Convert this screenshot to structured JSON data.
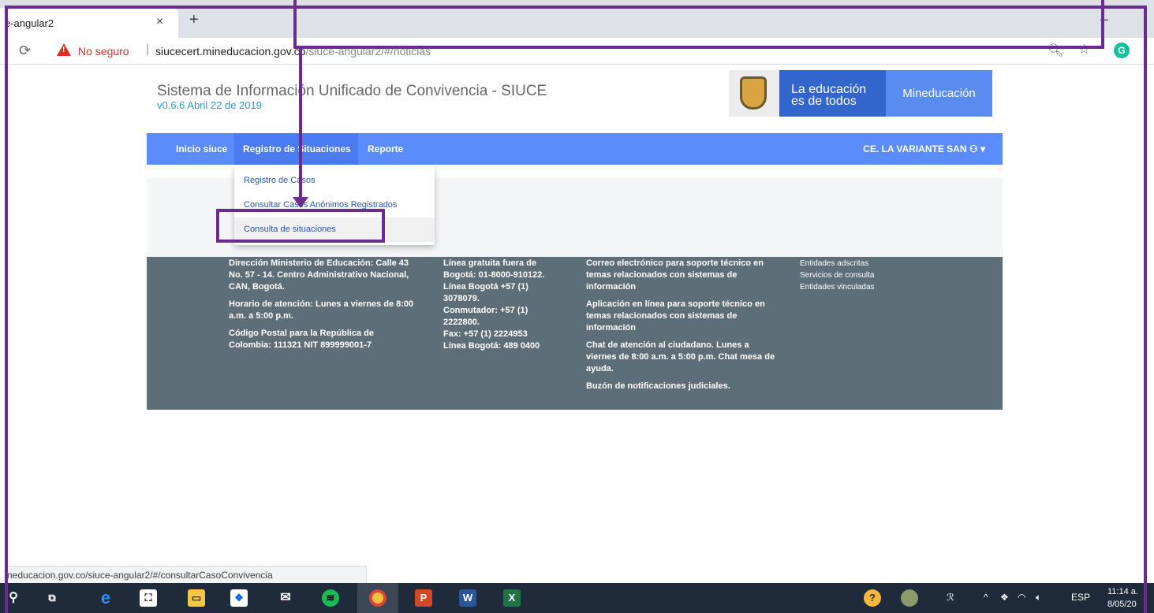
{
  "browser": {
    "tab_title": "e-angular2",
    "tab_close": "×",
    "new_tab": "+",
    "minimize": "–",
    "insecure_label": "No seguro",
    "url_host": "siucecert.mineducacion.gov.co",
    "url_path": "/siuce-angular2/#/noticias",
    "status_url": "neducacion.gov.co/siuce-angular2/#/consultarCasoConvivencia"
  },
  "header": {
    "title": "Sistema de Información Unificado de Convivencia - SIUCE",
    "version": "v0.6.6 Abril 22 de 2019",
    "logo_line1": "La educación",
    "logo_line2": "es de todos",
    "logo_ministry": "Mineducación"
  },
  "nav": {
    "items": [
      "Inicio siuce",
      "Registro de Situaciones",
      "Reporte"
    ],
    "user": "CE. LA VARIANTE SAN"
  },
  "dropdown": {
    "items": [
      "Registro de Casos",
      "Consultar Casos Anónimos Registrados",
      "Consulta de situaciones"
    ]
  },
  "footer": {
    "col1": [
      "Dirección Ministerio de Educación: Calle 43 No. 57 - 14. Centro Administrativo Nacional, CAN, Bogotá.",
      "Horario de atención: Lunes a viernes de 8:00 a.m. a 5:00 p.m.",
      "Código Postal para la República de Colombia: 111321 NIT 899999001-7"
    ],
    "col2": [
      "Línea gratuita fuera de Bogotá: 01-8000-910122.",
      "Línea Bogotá +57 (1) 3078079.",
      "Conmutador: +57 (1) 2222800.",
      "Fax: +57 (1) 2224953",
      "Línea Bogotá: 489 0400"
    ],
    "col3": [
      "Correo electrónico para soporte técnico en temas relacionados con sistemas de información",
      "Aplicación en línea para soporte técnico en temas relacionados con sistemas de información",
      "Chat de atención al ciudadano. Lunes a viernes de 8:00 a.m. a 5:00 p.m. Chat mesa de ayuda.",
      "Buzón de notificaciones judiciales."
    ],
    "col4": [
      "Entidades adscritas",
      "Servicios de consulta",
      "Entidades vinculadas"
    ]
  },
  "taskbar": {
    "icons": [
      "search-icon",
      "task-view-icon",
      "edge-icon",
      "store-icon",
      "file-explorer-icon",
      "dropbox-icon",
      "mail-icon",
      "spotify-icon",
      "chrome-icon",
      "powerpoint-icon",
      "word-icon",
      "excel-icon"
    ],
    "lang": "ESP",
    "time": "11:14 a.",
    "date": "8/05/20"
  },
  "colors": {
    "nav": "#5b8cfb",
    "footer": "#5e6e78",
    "annotation": "#6b2c91",
    "link": "#2a55a8"
  }
}
